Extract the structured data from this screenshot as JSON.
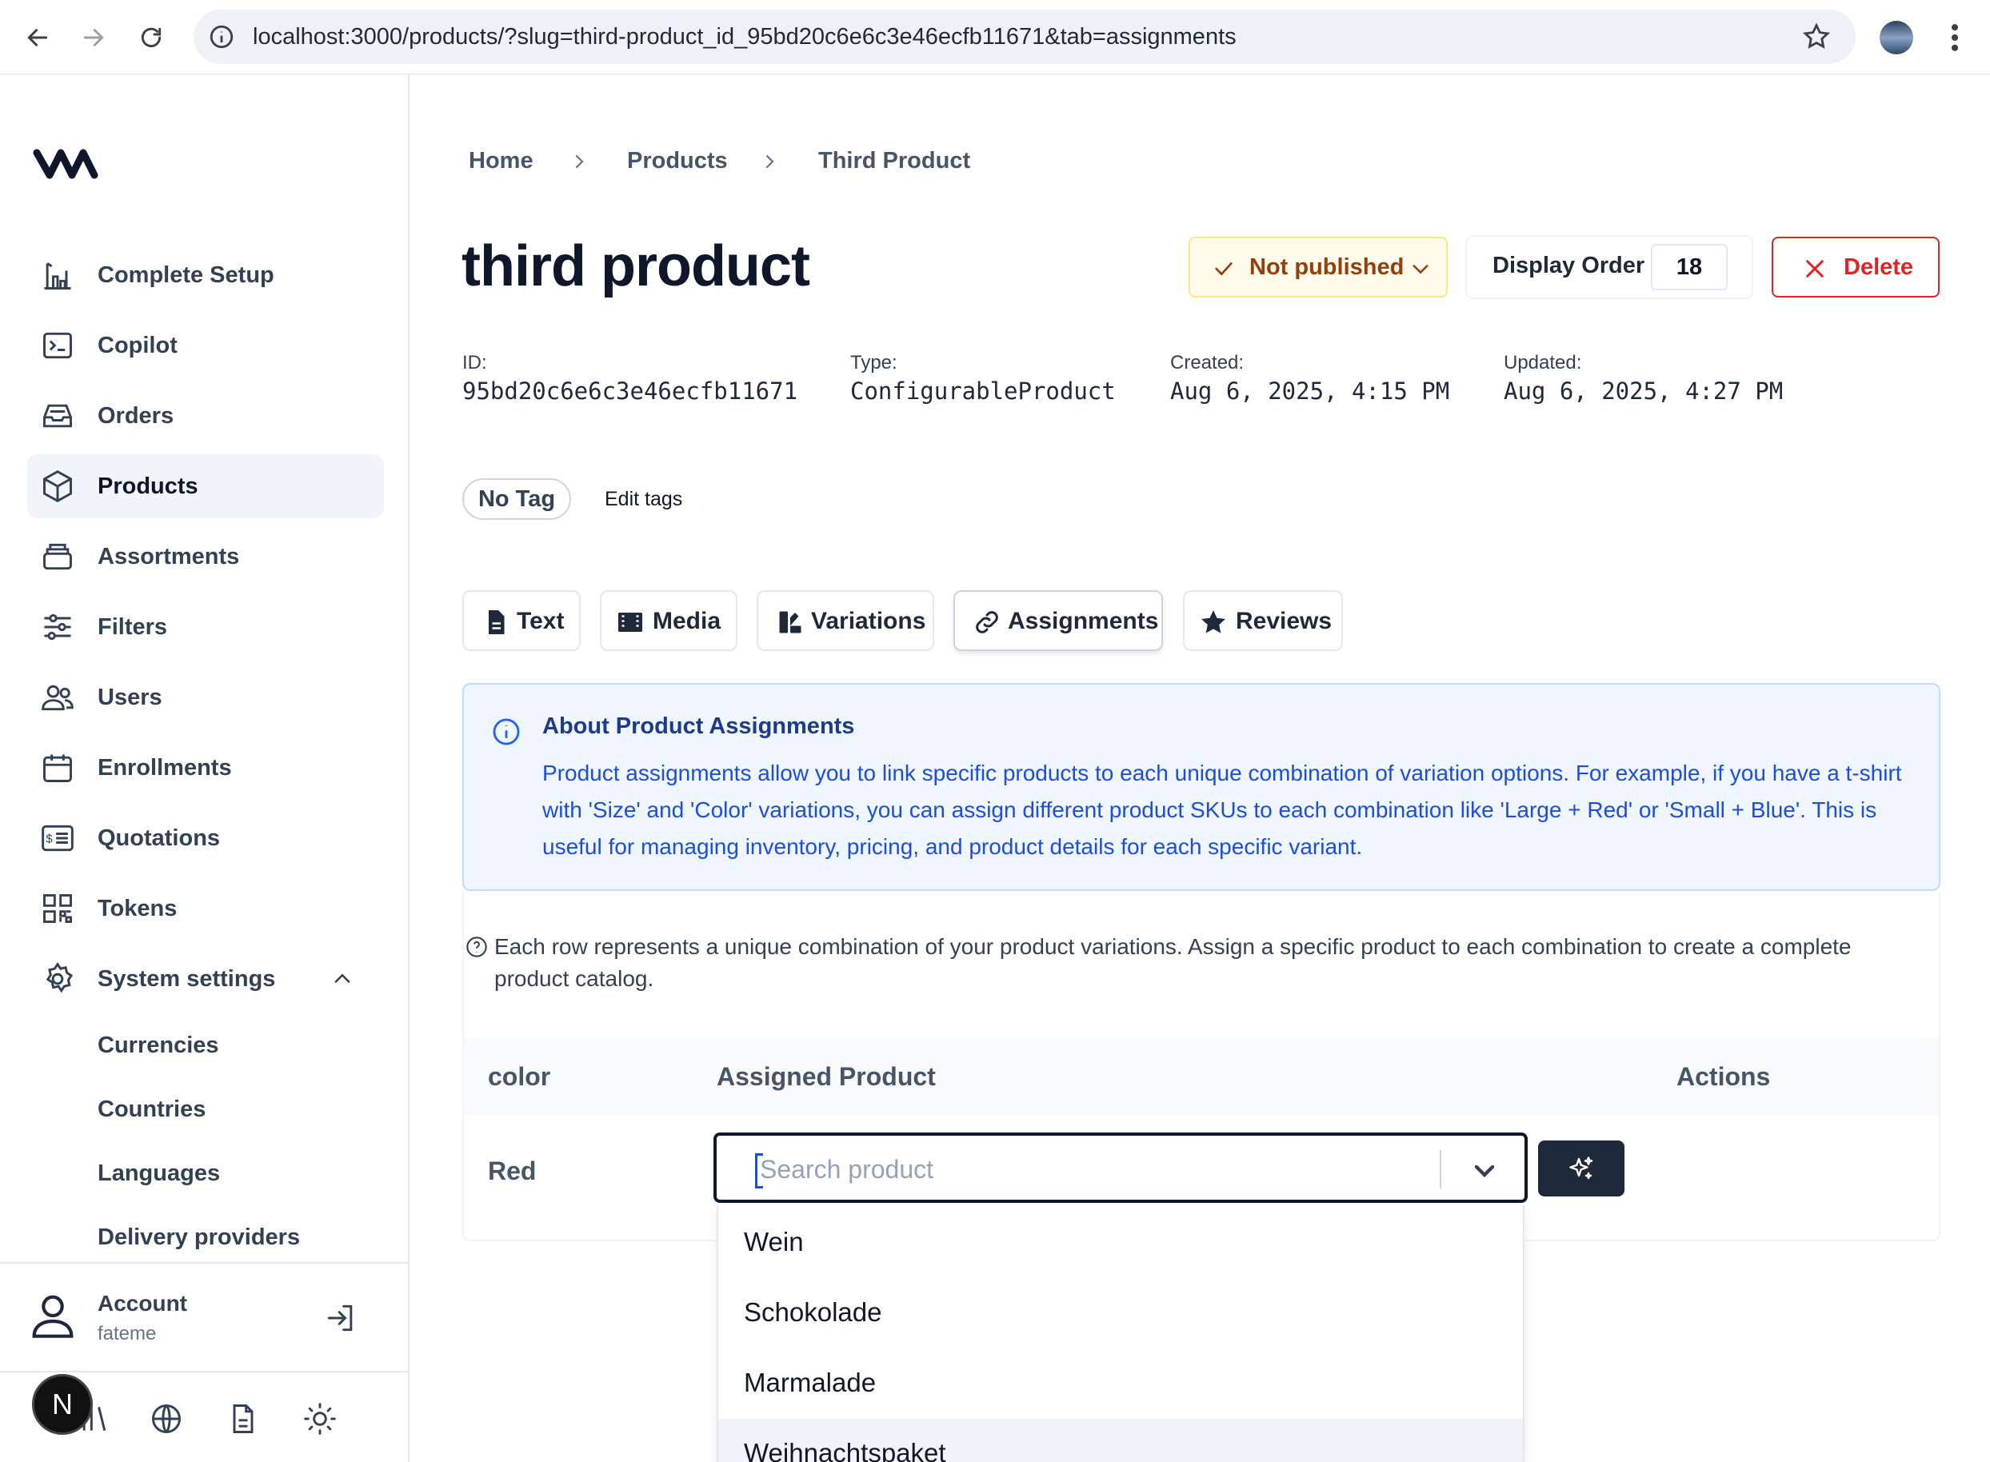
{
  "browser": {
    "url": "localhost:3000/products/?slug=third-product_id_95bd20c6e6c3e46ecfb11671&tab=assignments"
  },
  "sidebar": {
    "items": [
      {
        "label": "Complete Setup",
        "icon": "chart-setup-icon"
      },
      {
        "label": "Copilot",
        "icon": "terminal-icon"
      },
      {
        "label": "Orders",
        "icon": "inbox-icon"
      },
      {
        "label": "Products",
        "icon": "cube-icon",
        "active": true
      },
      {
        "label": "Assortments",
        "icon": "stack-icon"
      },
      {
        "label": "Filters",
        "icon": "sliders-icon"
      },
      {
        "label": "Users",
        "icon": "users-icon"
      },
      {
        "label": "Enrollments",
        "icon": "calendar-icon"
      },
      {
        "label": "Quotations",
        "icon": "receipt-icon"
      },
      {
        "label": "Tokens",
        "icon": "qr-icon"
      },
      {
        "label": "System settings",
        "icon": "gear-icon"
      }
    ],
    "subitems": [
      "Currencies",
      "Countries",
      "Languages",
      "Delivery providers"
    ],
    "account": {
      "label": "Account",
      "user": "fateme"
    },
    "badge": "N"
  },
  "breadcrumb": [
    "Home",
    "Products",
    "Third Product"
  ],
  "product": {
    "title": "third product",
    "status": "Not published",
    "display_order_label": "Display Order",
    "display_order": "18",
    "delete_label": "Delete",
    "meta": [
      {
        "label": "ID:",
        "value": "95bd20c6e6c3e46ecfb11671"
      },
      {
        "label": "Type:",
        "value": "ConfigurableProduct"
      },
      {
        "label": "Created:",
        "value": "Aug 6, 2025, 4:15 PM"
      },
      {
        "label": "Updated:",
        "value": "Aug 6, 2025, 4:27 PM"
      }
    ],
    "tag": "No Tag",
    "edit_tags": "Edit tags"
  },
  "tabs": [
    {
      "label": "Text"
    },
    {
      "label": "Media"
    },
    {
      "label": "Variations"
    },
    {
      "label": "Assignments",
      "active": true
    },
    {
      "label": "Reviews"
    }
  ],
  "info": {
    "title": "About Product Assignments",
    "body": "Product assignments allow you to link specific products to each unique combination of variation options. For example, if you have a t-shirt with 'Size' and 'Color' variations, you can assign different product SKUs to each combination like 'Large + Red' or 'Small + Blue'. This is useful for managing inventory, pricing, and product details for each specific variant."
  },
  "help_text": "Each row represents a unique combination of your product variations. Assign a specific product to each combination to create a complete product catalog.",
  "table": {
    "headers": [
      "color",
      "Assigned Product",
      "Actions"
    ],
    "rows": [
      {
        "color": "Red"
      }
    ]
  },
  "search": {
    "placeholder": "Search product",
    "options": [
      "Wein",
      "Schokolade",
      "Marmalade",
      "Weihnachtspaket"
    ]
  },
  "colors": {
    "accent_dark": "#1e293b",
    "info_bg": "#eff6ff",
    "warning_bg": "#fffbeb",
    "danger": "#dc2626"
  }
}
